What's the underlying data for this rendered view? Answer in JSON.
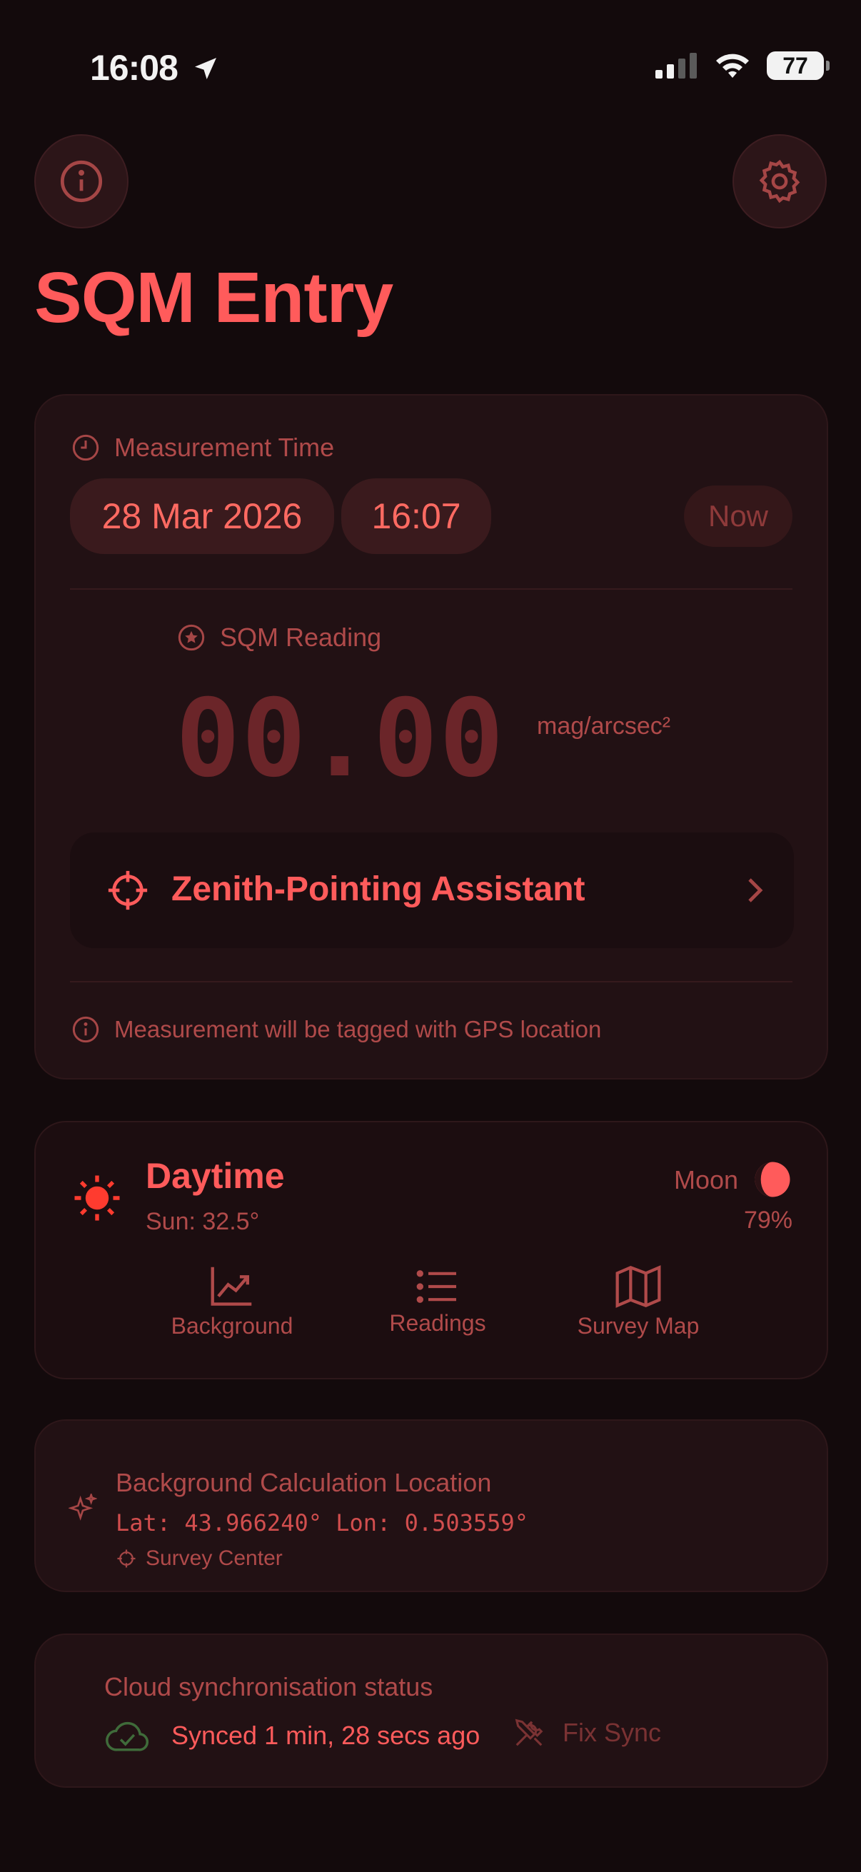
{
  "status_bar": {
    "time": "16:08",
    "battery": "77"
  },
  "header": {
    "title": "SQM Entry",
    "info_icon": "info-icon",
    "settings_icon": "gear-icon"
  },
  "measurement": {
    "label": "Measurement Time",
    "date": "28 Mar 2026",
    "time": "16:07",
    "now_label": "Now",
    "sqm_label": "SQM Reading",
    "sqm_value": "00.00",
    "sqm_unit": "mag/arcsec²",
    "zenith_label": "Zenith-Pointing Assistant",
    "gps_note": "Measurement will be tagged with GPS location"
  },
  "sky": {
    "state": "Daytime",
    "sun": "Sun: 32.5°",
    "moon_label": "Moon",
    "moon_pct": "79%",
    "actions": [
      {
        "label": "Background",
        "icon": "chart-icon"
      },
      {
        "label": "Readings",
        "icon": "list-icon"
      },
      {
        "label": "Survey Map",
        "icon": "map-icon"
      }
    ]
  },
  "location": {
    "title": "Background Calculation Location",
    "coords": "Lat: 43.966240° Lon: 0.503559°",
    "source": "Survey Center"
  },
  "sync": {
    "title": "Cloud synchronisation status",
    "status": "Synced 1 min, 28 secs ago",
    "fix_label": "Fix Sync"
  },
  "colors": {
    "background": "#130a0c",
    "card": "#221114",
    "accent": "#ff5b5b",
    "muted": "#b04a4a",
    "sync_ok": "#3f6b3a"
  }
}
